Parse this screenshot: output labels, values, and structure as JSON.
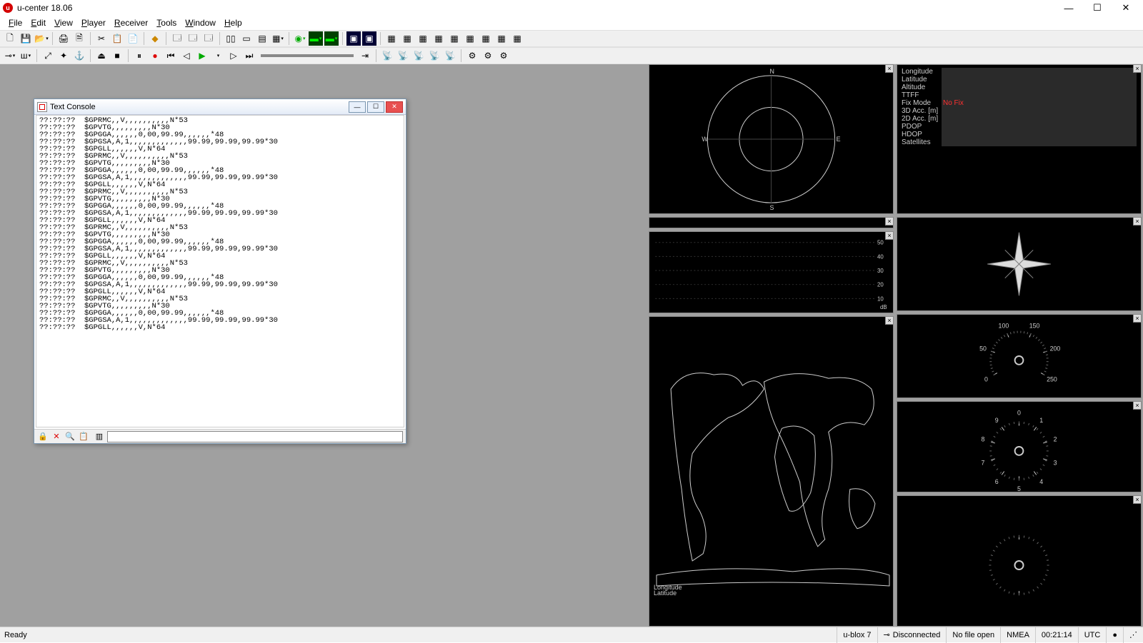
{
  "app": {
    "title": "u-center 18.06"
  },
  "menu": [
    "File",
    "Edit",
    "View",
    "Player",
    "Receiver",
    "Tools",
    "Window",
    "Help"
  ],
  "console": {
    "title": "Text Console",
    "lines": [
      "??:??:??  $GPRMC,,V,,,,,,,,,,N*53",
      "??:??:??  $GPVTG,,,,,,,,,N*30",
      "??:??:??  $GPGGA,,,,,,0,00,99.99,,,,,,*48",
      "??:??:??  $GPGSA,A,1,,,,,,,,,,,,,99.99,99.99,99.99*30",
      "??:??:??  $GPGLL,,,,,,V,N*64",
      "??:??:??  $GPRMC,,V,,,,,,,,,,N*53",
      "??:??:??  $GPVTG,,,,,,,,,N*30",
      "??:??:??  $GPGGA,,,,,,0,00,99.99,,,,,,*48",
      "??:??:??  $GPGSA,A,1,,,,,,,,,,,,,99.99,99.99,99.99*30",
      "??:??:??  $GPGLL,,,,,,V,N*64",
      "??:??:??  $GPRMC,,V,,,,,,,,,,N*53",
      "??:??:??  $GPVTG,,,,,,,,,N*30",
      "??:??:??  $GPGGA,,,,,,0,00,99.99,,,,,,*48",
      "??:??:??  $GPGSA,A,1,,,,,,,,,,,,,99.99,99.99,99.99*30",
      "??:??:??  $GPGLL,,,,,,V,N*64",
      "??:??:??  $GPRMC,,V,,,,,,,,,,N*53",
      "??:??:??  $GPVTG,,,,,,,,,N*30",
      "??:??:??  $GPGGA,,,,,,0,00,99.99,,,,,,*48",
      "??:??:??  $GPGSA,A,1,,,,,,,,,,,,,99.99,99.99,99.99*30",
      "??:??:??  $GPGLL,,,,,,V,N*64",
      "??:??:??  $GPRMC,,V,,,,,,,,,,N*53",
      "??:??:??  $GPVTG,,,,,,,,,N*30",
      "??:??:??  $GPGGA,,,,,,0,00,99.99,,,,,,*48",
      "??:??:??  $GPGSA,A,1,,,,,,,,,,,,,99.99,99.99,99.99*30",
      "??:??:??  $GPGLL,,,,,,V,N*64",
      "??:??:??  $GPRMC,,V,,,,,,,,,,N*53",
      "??:??:??  $GPVTG,,,,,,,,,N*30",
      "??:??:??  $GPGGA,,,,,,0,00,99.99,,,,,,*48",
      "??:??:??  $GPGSA,A,1,,,,,,,,,,,,,99.99,99.99,99.99*30",
      "??:??:??  $GPGLL,,,,,,V,N*64"
    ]
  },
  "info": {
    "keys": [
      "Longitude",
      "Latitude",
      "Altitude",
      "TTFF",
      "Fix Mode",
      "3D Acc. [m]",
      "2D Acc. [m]",
      "PDOP",
      "HDOP",
      "Satellites"
    ],
    "fixmode": "No Fix"
  },
  "signal": {
    "ticks": [
      "50",
      "40",
      "30",
      "20",
      "10"
    ],
    "unit": "dB"
  },
  "gauge1": {
    "labels": [
      "0",
      "50",
      "100",
      "150",
      "200",
      "250"
    ]
  },
  "gauge2": {
    "labels": [
      "0",
      "1",
      "2",
      "3",
      "4",
      "5",
      "6",
      "7",
      "8",
      "9"
    ]
  },
  "map": {
    "x": "Longitude",
    "y": "Latitude"
  },
  "compass_dirs": [
    "N",
    "E",
    "S",
    "W"
  ],
  "status": {
    "ready": "Ready",
    "device": "u-blox 7",
    "conn": "Disconnected",
    "file": "No file open",
    "proto": "NMEA",
    "time": "00:21:14",
    "tz": "UTC"
  }
}
